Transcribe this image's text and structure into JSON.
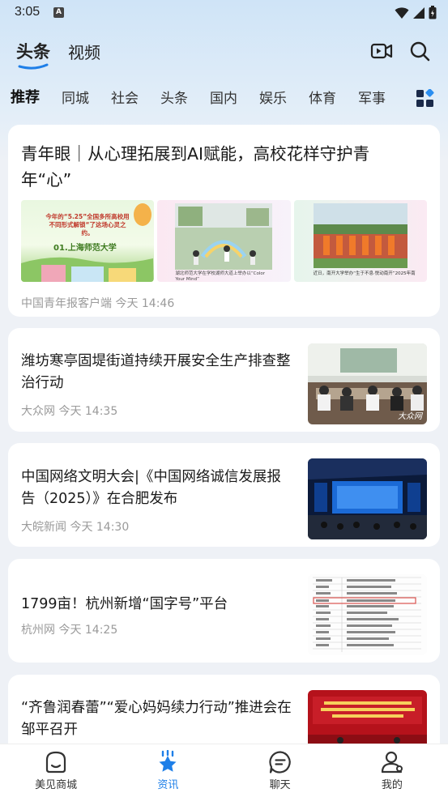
{
  "status": {
    "time": "3:05",
    "sim_glyph": "A"
  },
  "top_tabs": [
    {
      "label": "头条",
      "active": true
    },
    {
      "label": "视频",
      "active": false
    }
  ],
  "channels": [
    "推荐",
    "同城",
    "社会",
    "头条",
    "国内",
    "娱乐",
    "体育",
    "军事"
  ],
  "feed": {
    "big": {
      "title": "青年眼｜从心理拓展到AI赋能，高校花样守护青年“心”",
      "meta": "中国青年报客户端 今天 14:46",
      "thumb1_text": "今年的“5.25”全国多所高校用不同形式解锁“了这场心灵之约。",
      "thumb1_sub": "01.上海师范大学",
      "thumb2_text": "湖北师范大学在学校湖师大道上举办以“Color Your Mind”",
      "thumb3_text": "近日，南开大学举办“生于不息·悦动南开”2025年南"
    },
    "items": [
      {
        "title": "潍坊寒亭固堤街道持续开展安全生产排查整治行动",
        "source": "大众网",
        "time": "今天 14:35",
        "img_watermark": "大众网"
      },
      {
        "title": "中国网络文明大会|《中国网络诚信发展报告（2025）》在合肥发布",
        "source": "大皖新闻",
        "time": "今天 14:30"
      },
      {
        "title": "1799亩！杭州新增“国字号”平台",
        "source": "杭州网",
        "time": "今天 14:25"
      },
      {
        "title": "“齐鲁润春蕾”“爱心妈妈续力行动”推进会在邹平召开",
        "source": "",
        "time": ""
      }
    ]
  },
  "bottom_nav": [
    {
      "label": "美见商城",
      "icon": "shop-face-icon"
    },
    {
      "label": "资讯",
      "icon": "news-star-icon",
      "active": true
    },
    {
      "label": "聊天",
      "icon": "chat-bubble-icon"
    },
    {
      "label": "我的",
      "icon": "person-icon"
    }
  ],
  "colors": {
    "accent": "#1e7fe8",
    "meta_gray": "#9a9a9a"
  }
}
